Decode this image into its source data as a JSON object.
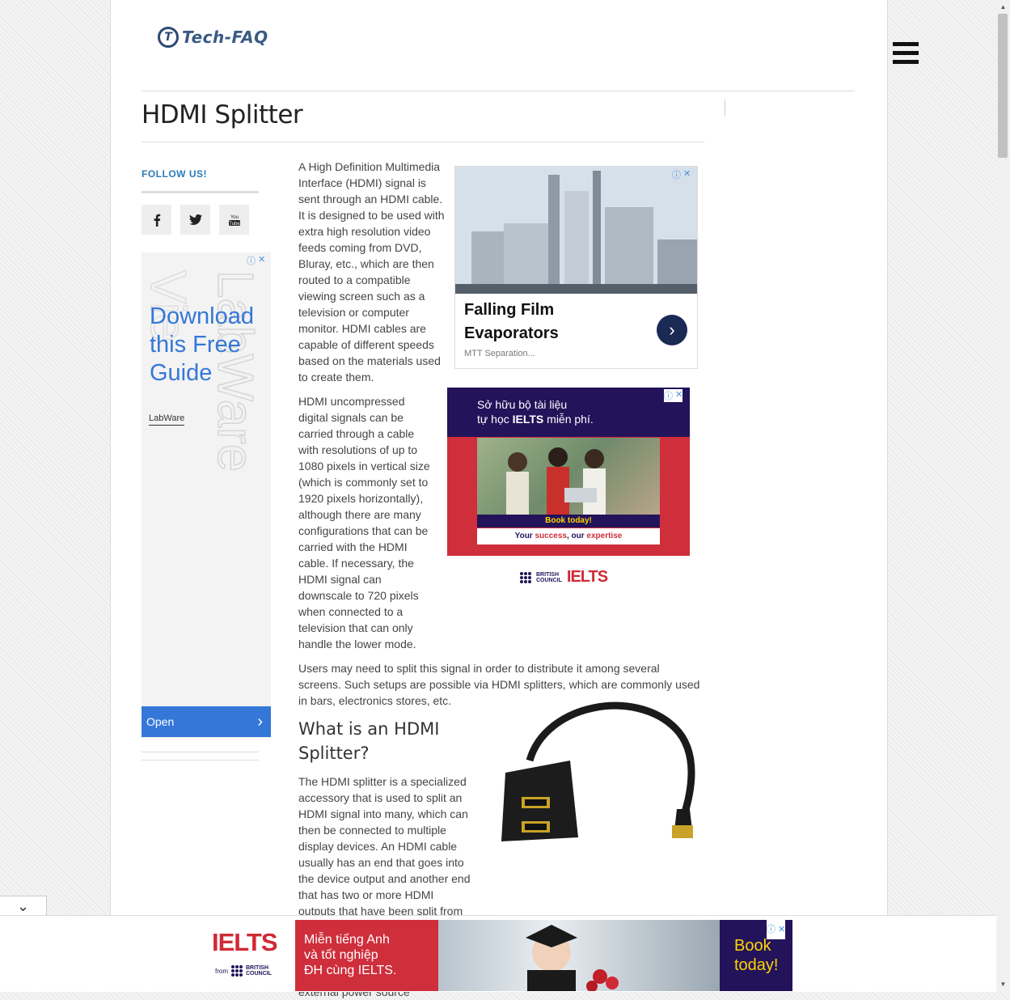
{
  "site": {
    "logo_mark": "T",
    "logo_text": "Tech-FAQ"
  },
  "article": {
    "title": "HDMI Splitter",
    "p1": "A High Definition Multimedia Interface (HDMI) signal is sent through an HDMI cable. It is designed to be used with extra high resolution video feeds coming from DVD, Bluray, etc., which are then routed to a compatible viewing screen such as a television or computer monitor. HDMI cables are capable of different speeds based on the materials used to create them.",
    "p2": "HDMI uncompressed digital signals can be carried through a cable with resolutions of up to 1080 pixels in vertical size (which is commonly set to 1920 pixels horizontally), although there are many configurations that can be carried with the HDMI cable. If necessary, the HDMI signal can downscale to 720 pixels when connected to a television that can only handle the lower mode.",
    "p3": "Users may need to split this signal in order to distribute it among several screens. Such setups are possible via HDMI splitters, which are commonly used in bars, electronics stores, etc.",
    "h2": "What is an HDMI Splitter?",
    "p4": "The HDMI splitter is a specialized accessory that is used to split an HDMI signal into many, which can then be connected to multiple display devices. An HDMI cable usually has an end that goes into the device output and another end that has two or more HDMI outputs that have been split from the single line. Alternatively, hardware splitters are connected to the output device via an HDMI cable and are used with an external power source"
  },
  "sidebar": {
    "follow_label": "FOLLOW US!",
    "social": [
      "f",
      "t",
      "You\nTube"
    ],
    "ad": {
      "headline": "Download this Free Guide",
      "brand": "LabWare",
      "watermark": "LabWare",
      "open_label": "Open",
      "chevron": "›"
    }
  },
  "ads": {
    "falling_film": {
      "title": "Falling Film Evaporators",
      "sub": "MTT Separation...",
      "btn": "›"
    },
    "ielts_box": {
      "line1": "Sở hữu bộ tài liệu",
      "line2_pre": "tự học ",
      "line2_bold": "IELTS",
      "line2_post": " miễn phí.",
      "book": "Book today!",
      "foot_pre": "Your ",
      "foot_bold1": "success",
      "foot_mid": ", our ",
      "foot_bold2": "expertise"
    },
    "british_council": {
      "line1": "BRITISH",
      "line2": "COUNCIL",
      "ielts": "IELTS"
    },
    "bottom": {
      "ielts": "IELTS",
      "from": "from",
      "bc1": "BRITISH",
      "bc2": "COUNCIL",
      "red1": "Miễn tiếng Anh",
      "red2": "và tốt nghiệp",
      "red3": "ĐH cùng IELTS.",
      "right1": "Book",
      "right2": "today!"
    },
    "adchoice_info": "ⓘ",
    "adchoice_close": "✕"
  },
  "ui": {
    "collapse_chevron": "⌄",
    "scroll_up": "▲",
    "scroll_down": "▼"
  },
  "colors": {
    "accent": "#2b7bb9",
    "ad_blue": "#3477d8",
    "ielts_red": "#cf2e3b",
    "ielts_navy": "#23135a"
  }
}
